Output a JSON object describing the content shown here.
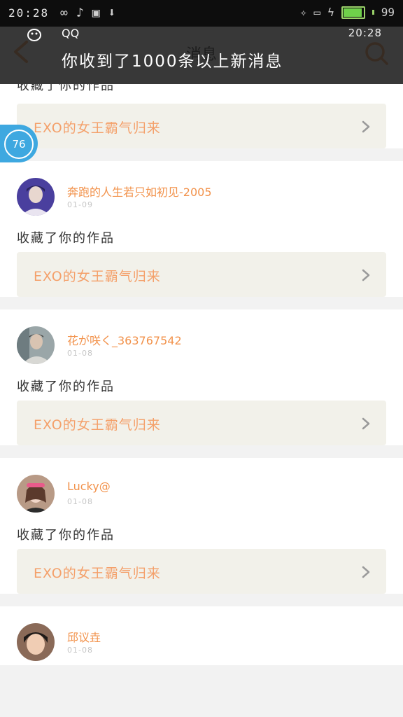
{
  "status_bar": {
    "time": "20:28",
    "battery": "99",
    "battery_fill_fraction": 0.99,
    "icons": [
      "infinity-icon",
      "music-note-icon",
      "image-icon",
      "download-icon",
      "gamepad-icon",
      "tablet-icon",
      "charging-icon"
    ]
  },
  "appbar": {
    "title": "消息"
  },
  "notification": {
    "app_name": "QQ",
    "time": "20:28",
    "message": "你收到了1000条以上新消息"
  },
  "floating_badge": {
    "count": "76"
  },
  "colors": {
    "accent": "#f2924b",
    "work_title": "#f4a06a",
    "work_box_bg": "#f2f1ea",
    "badge": "#3ea8e0"
  },
  "feed": {
    "first_partial": {
      "action": "收藏了你的作品",
      "work_title": "EXO的女王霸气归来"
    },
    "items": [
      {
        "username": "奔跑的人生若只如初见-2005",
        "date": "01-09",
        "action": "收藏了你的作品",
        "work_title": "EXO的女王霸气归来"
      },
      {
        "username": "花が咲く_363767542",
        "date": "01-08",
        "action": "收藏了你的作品",
        "work_title": "EXO的女王霸气归来"
      },
      {
        "username": "Lucky@",
        "date": "01-08",
        "action": "收藏了你的作品",
        "work_title": "EXO的女王霸气归来"
      },
      {
        "username": "邱议垚",
        "date": "01-08"
      }
    ]
  }
}
